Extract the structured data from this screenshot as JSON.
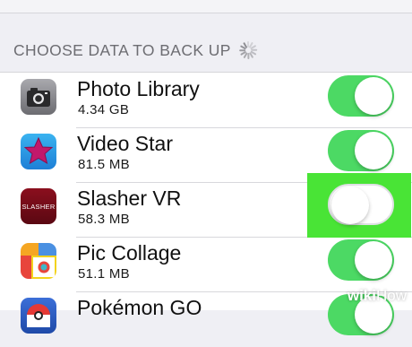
{
  "section": {
    "header": "CHOOSE DATA TO BACK UP",
    "spinner_icon": "loading-spinner-icon"
  },
  "apps": [
    {
      "name": "Photo Library",
      "size": "4.34 GB",
      "icon": "camera-icon",
      "enabled": true
    },
    {
      "name": "Video Star",
      "size": "81.5 MB",
      "icon": "star-icon",
      "enabled": true
    },
    {
      "name": "Slasher VR",
      "size": "58.3 MB",
      "icon": "slasher-vr-icon",
      "icon_text": "SLASHER",
      "enabled": false
    },
    {
      "name": "Pic Collage",
      "size": "51.1 MB",
      "icon": "pic-collage-icon",
      "enabled": true
    },
    {
      "name": "Pokémon GO",
      "size": "",
      "icon": "pokeball-icon",
      "enabled": true
    }
  ],
  "colors": {
    "toggle_on": "#4cd964",
    "highlight": "#49e436",
    "background": "#efeff4"
  },
  "watermark": {
    "bold": "wiki",
    "light": "How"
  }
}
